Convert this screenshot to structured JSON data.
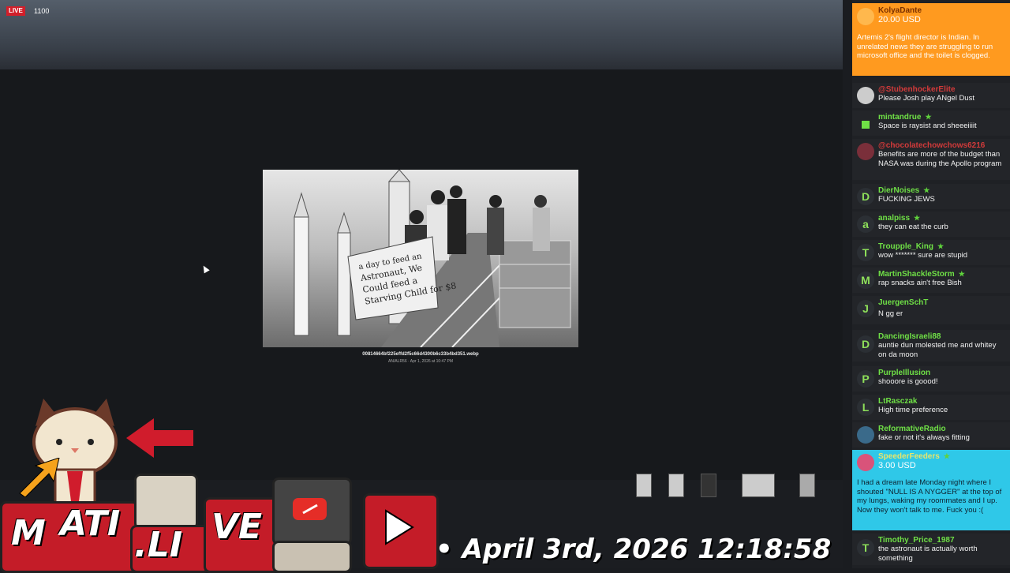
{
  "stream": {
    "live_label": "LIVE",
    "viewer_count": "1100"
  },
  "viewer": {
    "file_name": "00814664bf225effd2f5c66d4300b6c33b4bd351.webp",
    "file_meta": "AN/ALR56 · Apr 1, 2026 at 10:47 PM",
    "photo_sign_text": "$12 a day to feed an Astronaut. We Could feed a Starving Child for $8",
    "thumbnail_count": 5
  },
  "overlay": {
    "logo_letters": [
      "M",
      "ATI",
      ".LI",
      "VE"
    ],
    "clock": "• April 3rd, 2026 12:18:58"
  },
  "chat": {
    "messages": [
      {
        "user": "KolyaDante",
        "amount": "20.00 USD",
        "text": "Artemis 2's flight director is Indian. In unrelated news they are struggling to run microsoft office and the toilet is clogged.",
        "type": "donation"
      },
      {
        "user": "@StubenhockerElite",
        "text": "Please Josh play ANgel Dust",
        "avatar": "",
        "color": "red"
      },
      {
        "user": "mintandrue",
        "text": "Space is raysist and sheeeiiiit",
        "avatar": ""
      },
      {
        "user": "@chocolatechowchows6216",
        "text": "Benefits are more of the budget than NASA was during the Apollo program",
        "avatar": "",
        "color": "red"
      },
      {
        "user": "DierNoises",
        "text": "FUCKING JEWS",
        "avatar": "D"
      },
      {
        "user": "analpiss",
        "text": "they can eat the curb",
        "avatar": "a"
      },
      {
        "user": "Troupple_King",
        "text": "wow ******* sure are stupid",
        "avatar": "T"
      },
      {
        "user": "MartinShackleStorm",
        "text": "rap snacks ain't free Bish",
        "avatar": "M"
      },
      {
        "user": "JuergenSchT",
        "text": "N   gg   er",
        "avatar": "J"
      },
      {
        "user": "DancingIsraeli88",
        "text": "auntie dun molested me and whitey on da moon",
        "avatar": "D"
      },
      {
        "user": "PurpleIllusion",
        "text": "shooore is goood!",
        "avatar": "P"
      },
      {
        "user": "LtRasczak",
        "text": "High time preference",
        "avatar": "L"
      },
      {
        "user": "ReformativeRadio",
        "text": "fake or not it's always fitting",
        "avatar": ""
      },
      {
        "user": "SpeederFeeders",
        "amount": "3.00 USD",
        "text": "I had a dream late Monday night where I shouted \"NULL IS A NYGGER\" at the top of my lungs, waking my roommates and I up. Now they won't talk to me. Fuck you :(",
        "type": "donation2"
      },
      {
        "user": "Timothy_Price_1987",
        "text": "the astronaut is actually worth something",
        "avatar": "T"
      }
    ]
  },
  "colors": {
    "live_red": "#d21f2a",
    "chat_name_green": "#6fe046",
    "donation_orange": "#ff9a1f",
    "donation_cyan": "#2fc8e8"
  }
}
